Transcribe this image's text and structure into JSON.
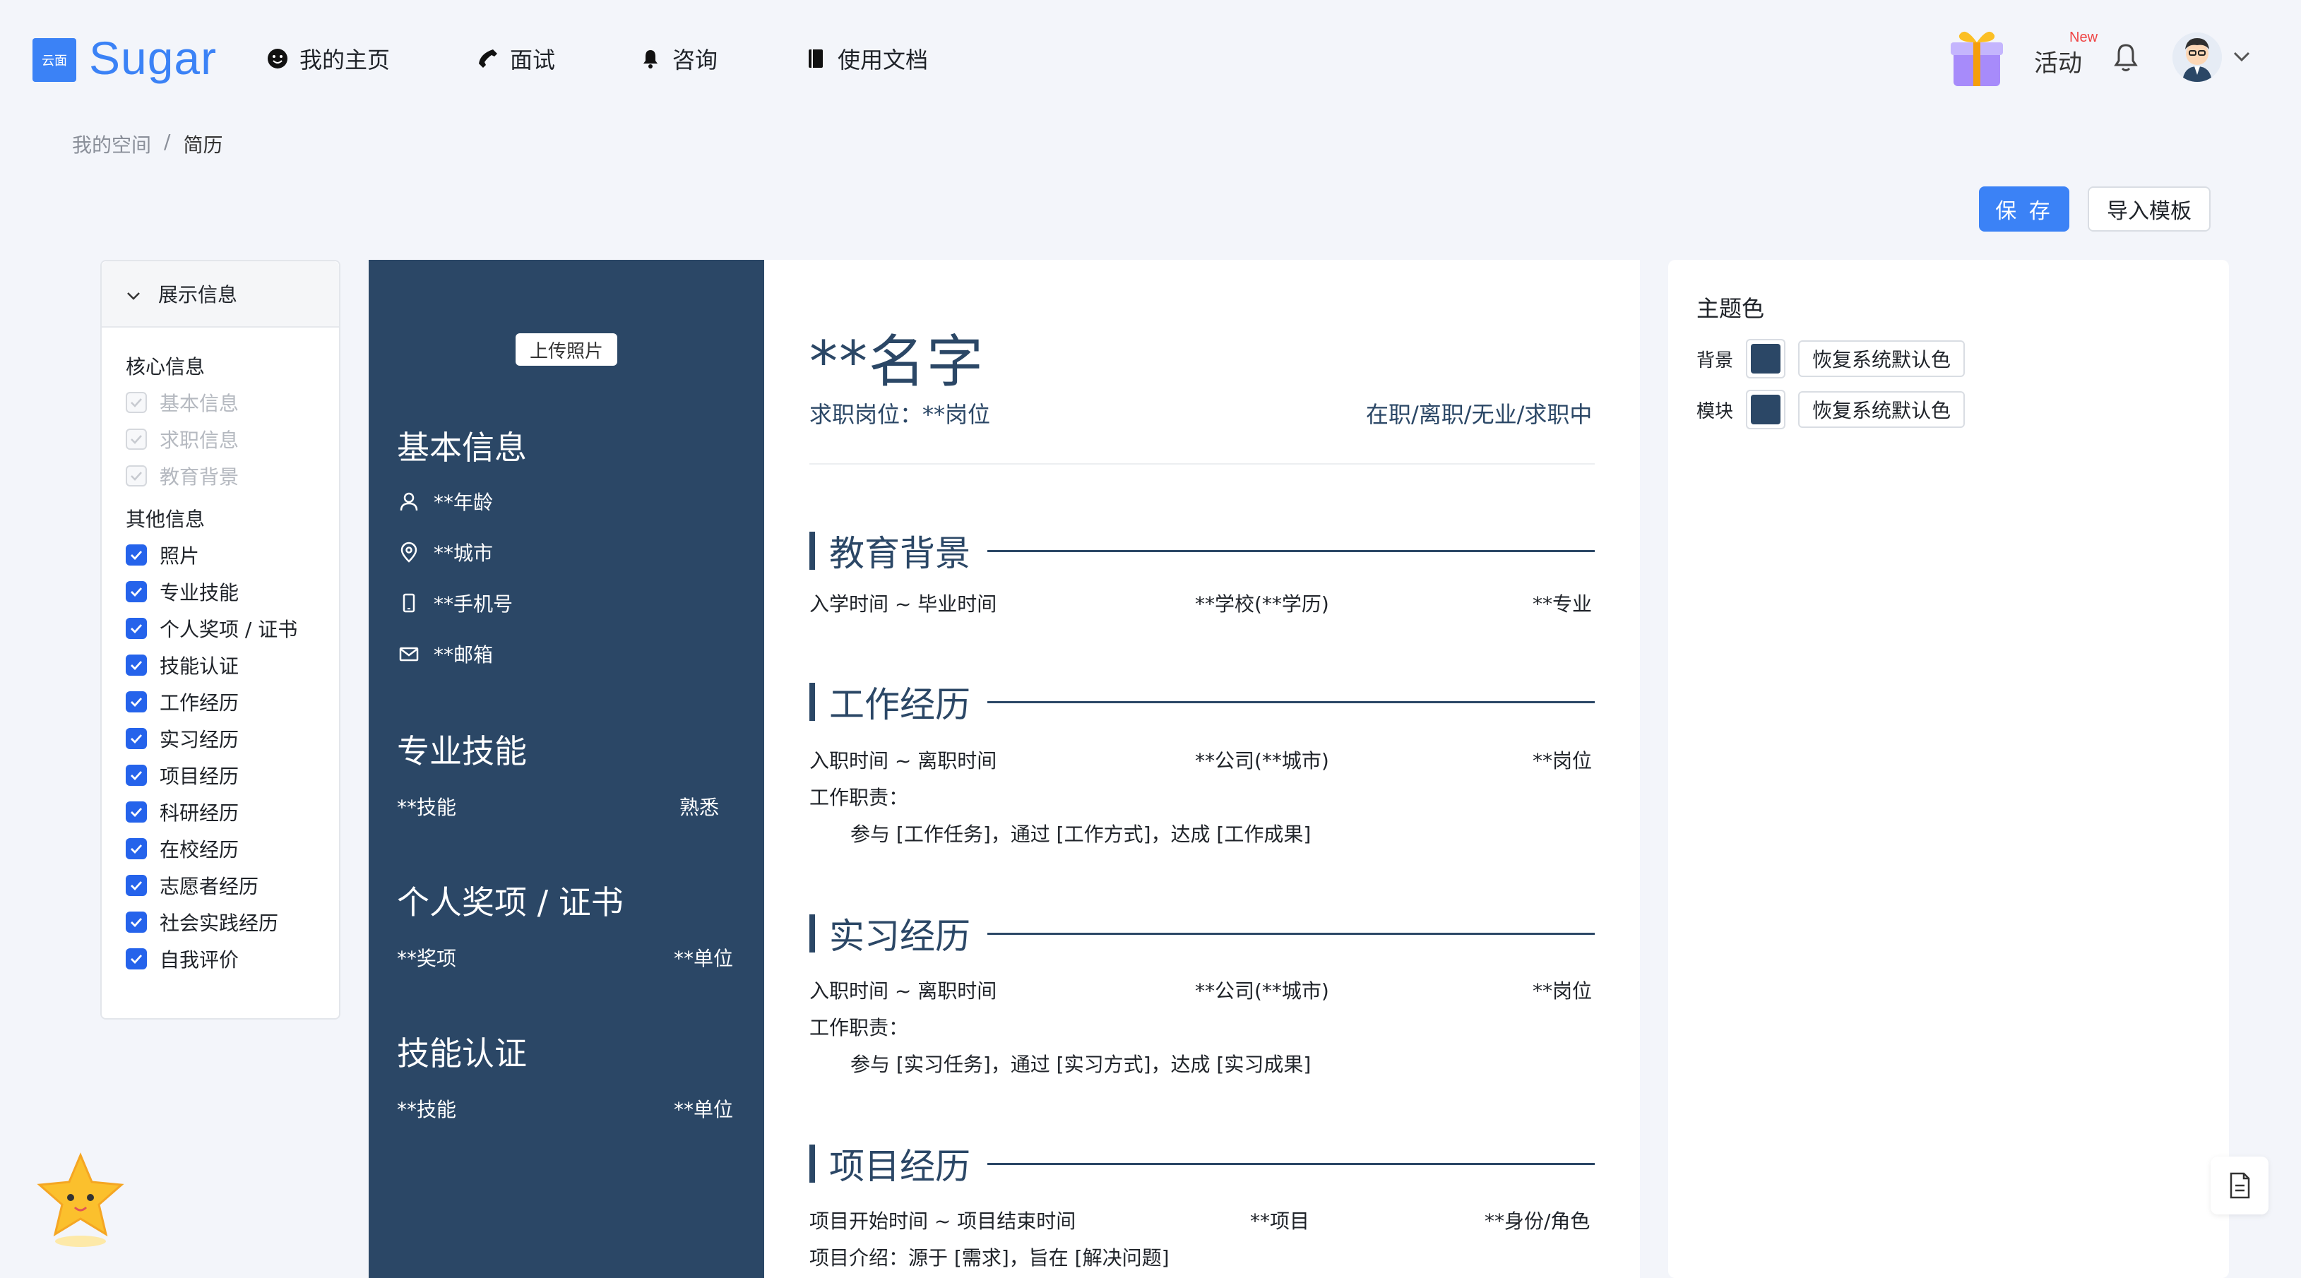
{
  "header": {
    "logo_mark": "云面",
    "logo_text": "Sugar",
    "nav": [
      {
        "label": "我的主页",
        "icon": "smile-icon"
      },
      {
        "label": "面试",
        "icon": "phone-icon"
      },
      {
        "label": "咨询",
        "icon": "bell-icon"
      },
      {
        "label": "使用文档",
        "icon": "book-icon"
      }
    ],
    "activity_label": "活动",
    "new_badge": "New"
  },
  "breadcrumb": {
    "root": "我的空间",
    "sep": "/",
    "current": "简历"
  },
  "actions": {
    "save_label": "保 存",
    "import_label": "导入模板"
  },
  "display_panel": {
    "title": "展示信息",
    "core_title": "核心信息",
    "core_items": [
      "基本信息",
      "求职信息",
      "教育背景"
    ],
    "other_title": "其他信息",
    "other_items": [
      "照片",
      "专业技能",
      "个人奖项 / 证书",
      "技能认证",
      "工作经历",
      "实习经历",
      "项目经历",
      "科研经历",
      "在校经历",
      "志愿者经历",
      "社会实践经历",
      "自我评价"
    ]
  },
  "resume": {
    "upload_photo": "上传照片",
    "basic_title": "基本信息",
    "age": "**年龄",
    "city": "**城市",
    "phone": "**手机号",
    "email": "**邮箱",
    "skills_title": "专业技能",
    "skill_name": "**技能",
    "skill_level": "熟悉",
    "awards_title": "个人奖项 / 证书",
    "award_name": "**奖项",
    "award_unit": "**单位",
    "cert_title": "技能认证",
    "cert_name": "**技能",
    "cert_unit": "**单位",
    "name": "**名字",
    "job_intent": "求职岗位：**岗位",
    "job_status": "在职/离职/无业/求职中",
    "education": {
      "title": "教育背景",
      "time": "入学时间 ~ 毕业时间",
      "school": "**学校(**学历)",
      "major": "**专业"
    },
    "work": {
      "title": "工作经历",
      "time": "入职时间 ~ 离职时间",
      "company": "**公司(**城市)",
      "position": "**岗位",
      "duty_label": "工作职责：",
      "duty": "参与 [工作任务]，通过 [工作方式]，达成 [工作成果]"
    },
    "intern": {
      "title": "实习经历",
      "time": "入职时间 ~ 离职时间",
      "company": "**公司(**城市)",
      "position": "**岗位",
      "duty_label": "工作职责：",
      "duty": "参与 [实习任务]，通过 [实习方式]，达成 [实习成果]"
    },
    "project": {
      "title": "项目经历",
      "time": "项目开始时间 ~ 项目结束时间",
      "name": "**项目",
      "role": "**身份/角色",
      "intro": "项目介绍：源于 [需求]，旨在 [解决问题]"
    }
  },
  "theme": {
    "title": "主题色",
    "bg_label": "背景",
    "module_label": "模块",
    "reset_label": "恢复系统默认色",
    "bg_color": "#2b4766",
    "module_color": "#2b4766",
    "accent_color": "#3b82f6"
  }
}
